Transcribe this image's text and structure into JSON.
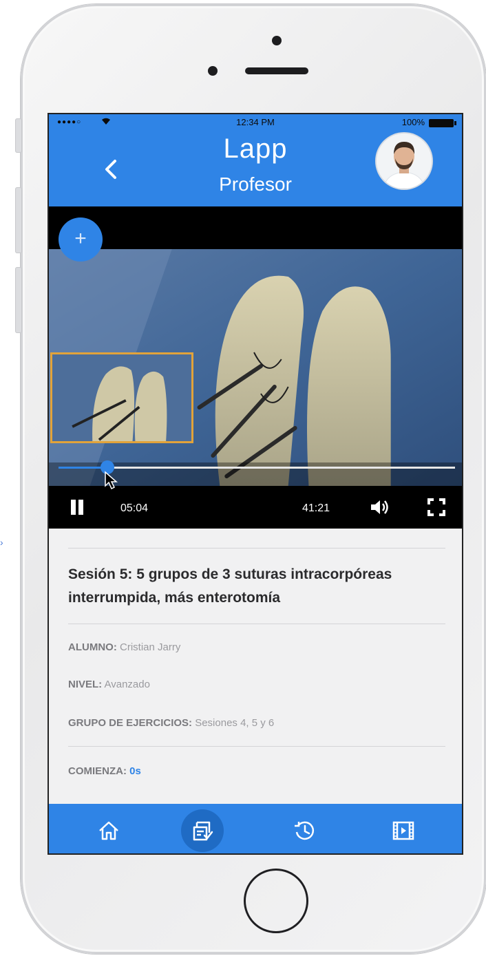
{
  "status_bar": {
    "signal": "●●●●○",
    "time": "12:34 PM",
    "battery": "100%"
  },
  "header": {
    "title": "Lapp",
    "subtitle": "Profesor"
  },
  "video": {
    "current_time": "05:04",
    "total_time": "41:21",
    "progress_fraction": 0.123,
    "add_label": "+"
  },
  "session": {
    "title": "Sesión 5: 5 grupos de 3 suturas intracorpóreas interrumpida, más enterotomía",
    "details": [
      {
        "key": "ALUMNO:",
        "value": "Cristian Jarry"
      },
      {
        "key": "NIVEL:",
        "value": "Avanzado"
      },
      {
        "key": "GRUPO DE EJERCICIOS:",
        "value": "Sesiones 4, 5 y 6"
      }
    ],
    "start": {
      "key": "COMIENZA:",
      "value": "0s"
    }
  },
  "tabbar": {
    "tabs": [
      {
        "icon": "home-icon"
      },
      {
        "icon": "evaluation-icon",
        "active": true
      },
      {
        "icon": "history-icon"
      },
      {
        "icon": "video-library-icon"
      }
    ]
  },
  "colors": {
    "accent": "#2f84e6",
    "pip_border": "#e2a33a",
    "video_background": "#000000"
  }
}
